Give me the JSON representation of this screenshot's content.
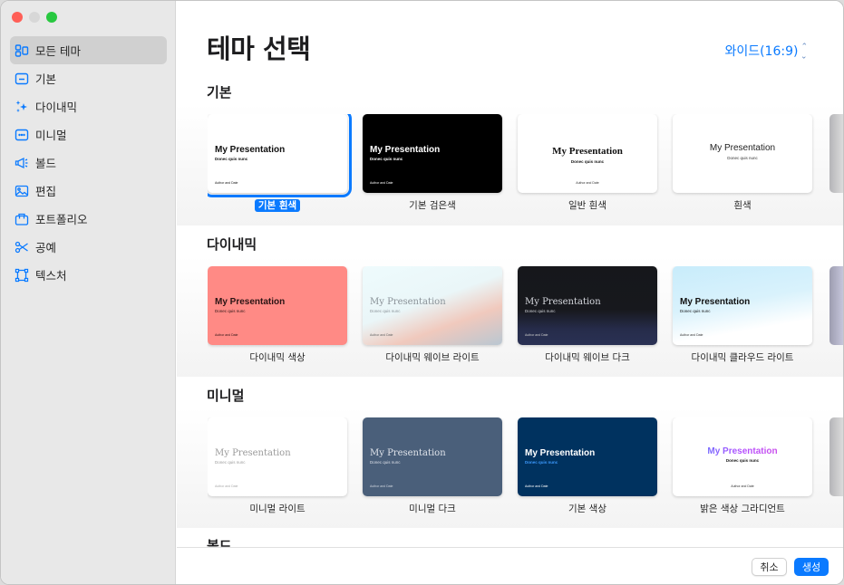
{
  "window": {
    "traffic_lights": [
      "close",
      "minimize",
      "maximize"
    ]
  },
  "sidebar": {
    "items": [
      {
        "label": "모든 테마",
        "icon": "grid-icon",
        "active": true
      },
      {
        "label": "기본",
        "icon": "basic-slide-icon",
        "active": false
      },
      {
        "label": "다이내믹",
        "icon": "sparkles-icon",
        "active": false
      },
      {
        "label": "미니멀",
        "icon": "ellipsis-slide-icon",
        "active": false
      },
      {
        "label": "볼드",
        "icon": "megaphone-icon",
        "active": false
      },
      {
        "label": "편집",
        "icon": "photo-icon",
        "active": false
      },
      {
        "label": "포트폴리오",
        "icon": "briefcase-icon",
        "active": false
      },
      {
        "label": "공예",
        "icon": "scissors-icon",
        "active": false
      },
      {
        "label": "텍스처",
        "icon": "texture-frame-icon",
        "active": false
      }
    ]
  },
  "header": {
    "title": "테마 선택",
    "aspect_ratio": "와이드(16:9)"
  },
  "theme_text": {
    "title": "My Presentation",
    "subtitle": "Donec quis nunc",
    "author": "Author and Date"
  },
  "sections": [
    {
      "title": "기본",
      "themes": [
        {
          "label": "기본 흰색",
          "selected": true
        },
        {
          "label": "기본 검은색",
          "selected": false
        },
        {
          "label": "일반 흰색",
          "selected": false
        },
        {
          "label": "흰색",
          "selected": false
        }
      ]
    },
    {
      "title": "다이내믹",
      "themes": [
        {
          "label": "다이내믹 색상",
          "selected": false
        },
        {
          "label": "다이내믹 웨이브 라이트",
          "selected": false
        },
        {
          "label": "다이내믹 웨이브 다크",
          "selected": false
        },
        {
          "label": "다이내믹 클라우드 라이트",
          "selected": false
        }
      ]
    },
    {
      "title": "미니멀",
      "themes": [
        {
          "label": "미니멀 라이트",
          "selected": false
        },
        {
          "label": "미니멀 다크",
          "selected": false
        },
        {
          "label": "기본 색상",
          "selected": false
        },
        {
          "label": "밝은 색상 그라디언트",
          "selected": false
        }
      ]
    },
    {
      "title": "볼드",
      "themes": []
    }
  ],
  "footer": {
    "cancel_label": "취소",
    "create_label": "생성"
  },
  "colors": {
    "accent": "#0a7aff",
    "dynamic_color_bg": "#ff8a85",
    "minimal_dark_bg": "#4a5f7a",
    "basic_color_bg": "#00325f"
  }
}
